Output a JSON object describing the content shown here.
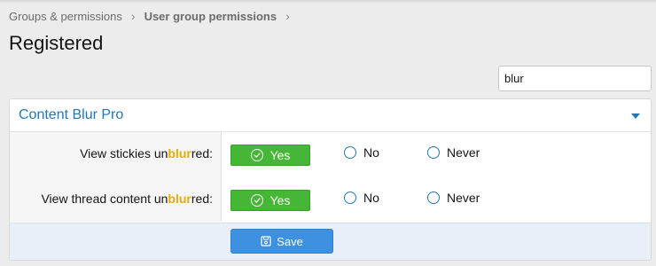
{
  "breadcrumb": {
    "items": [
      {
        "label": "Groups & permissions",
        "bold": false
      },
      {
        "label": "User group permissions",
        "bold": true
      }
    ],
    "separator": "›"
  },
  "page": {
    "title": "Registered"
  },
  "search": {
    "value": "blur"
  },
  "block": {
    "title": "Content Blur Pro",
    "rows": [
      {
        "label_prefix": "View stickies un",
        "label_highlight": "blur",
        "label_suffix": "red:",
        "options": {
          "yes": "Yes",
          "no": "No",
          "never": "Never"
        },
        "selected": "yes"
      },
      {
        "label_prefix": "View thread content un",
        "label_highlight": "blur",
        "label_suffix": "red:",
        "options": {
          "yes": "Yes",
          "no": "No",
          "never": "Never"
        },
        "selected": "yes"
      }
    ]
  },
  "footer": {
    "save_label": "Save"
  },
  "colors": {
    "accent": "#2577b1",
    "success": "#45b635",
    "highlight": "#e4ad08",
    "primary_button": "#3d91e0"
  },
  "icons": {
    "breadcrumb_separator": "chevron-right-icon",
    "collapse": "caret-down-icon",
    "yes": "check-circle-icon",
    "radio": "radio-circle-icon",
    "save": "save-icon"
  }
}
